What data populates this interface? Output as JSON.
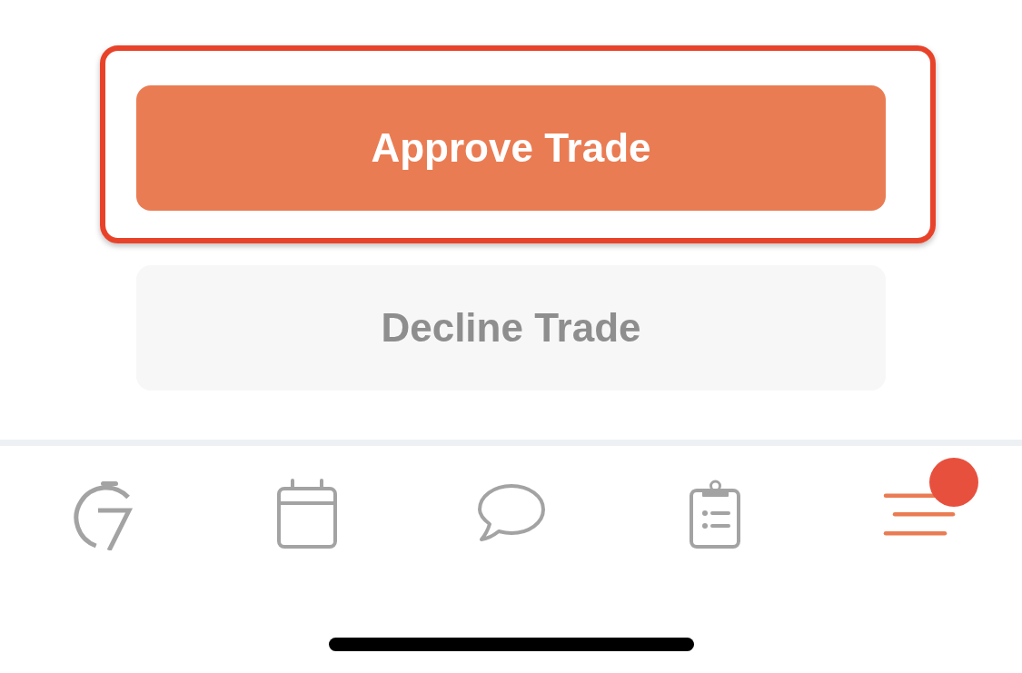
{
  "actions": [
    {
      "label": "Approve Trade",
      "kind": "primary",
      "highlighted": true
    },
    {
      "label": "Decline Trade",
      "kind": "secondary",
      "highlighted": false
    }
  ],
  "tab_bar": {
    "items": [
      {
        "selected": false,
        "notification": false
      },
      {
        "selected": false,
        "notification": false
      },
      {
        "selected": false,
        "notification": false
      },
      {
        "selected": false,
        "notification": false
      },
      {
        "selected": true,
        "notification": true
      }
    ]
  }
}
